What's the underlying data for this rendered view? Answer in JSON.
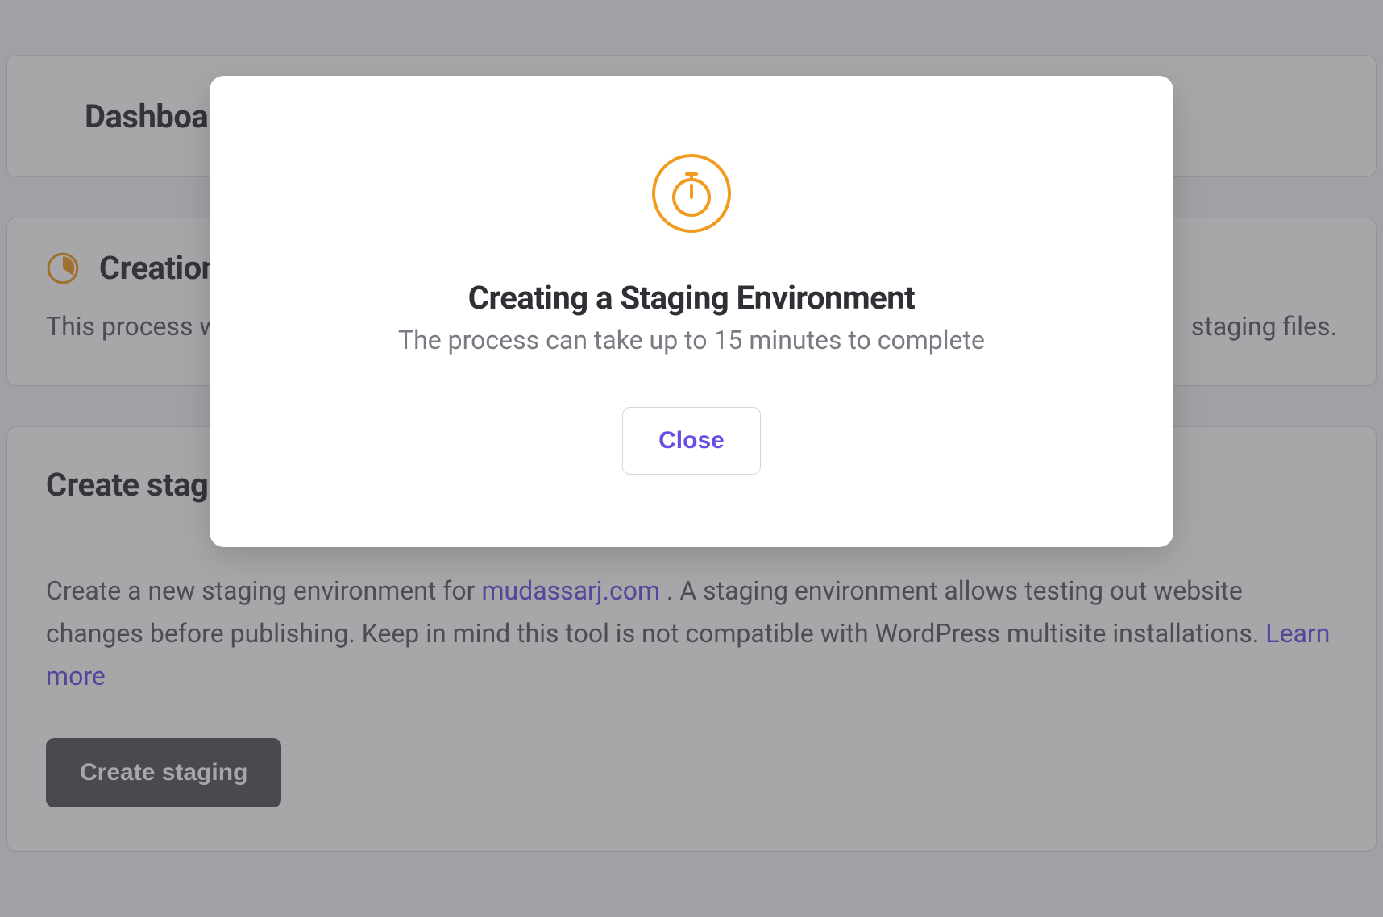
{
  "dashboard": {
    "title": "Dashboard"
  },
  "status_card": {
    "title": "Creation in progress",
    "body_lead": "This process will take a few minutes to complete.",
    "body_tail": "staging files."
  },
  "create_card": {
    "title": "Create staging",
    "body_lead": "Create a new staging environment for ",
    "domain": "mudassarj.com",
    "body_mid": " . A staging environment allows testing out website changes before publishing. Keep in mind this tool is not compatible with WordPress multisite installations. ",
    "learn_more": "Learn more",
    "button_label": "Create staging"
  },
  "modal": {
    "title": "Creating a Staging Environment",
    "subtitle": "The process can take up to 15 minutes to complete",
    "close_label": "Close"
  }
}
